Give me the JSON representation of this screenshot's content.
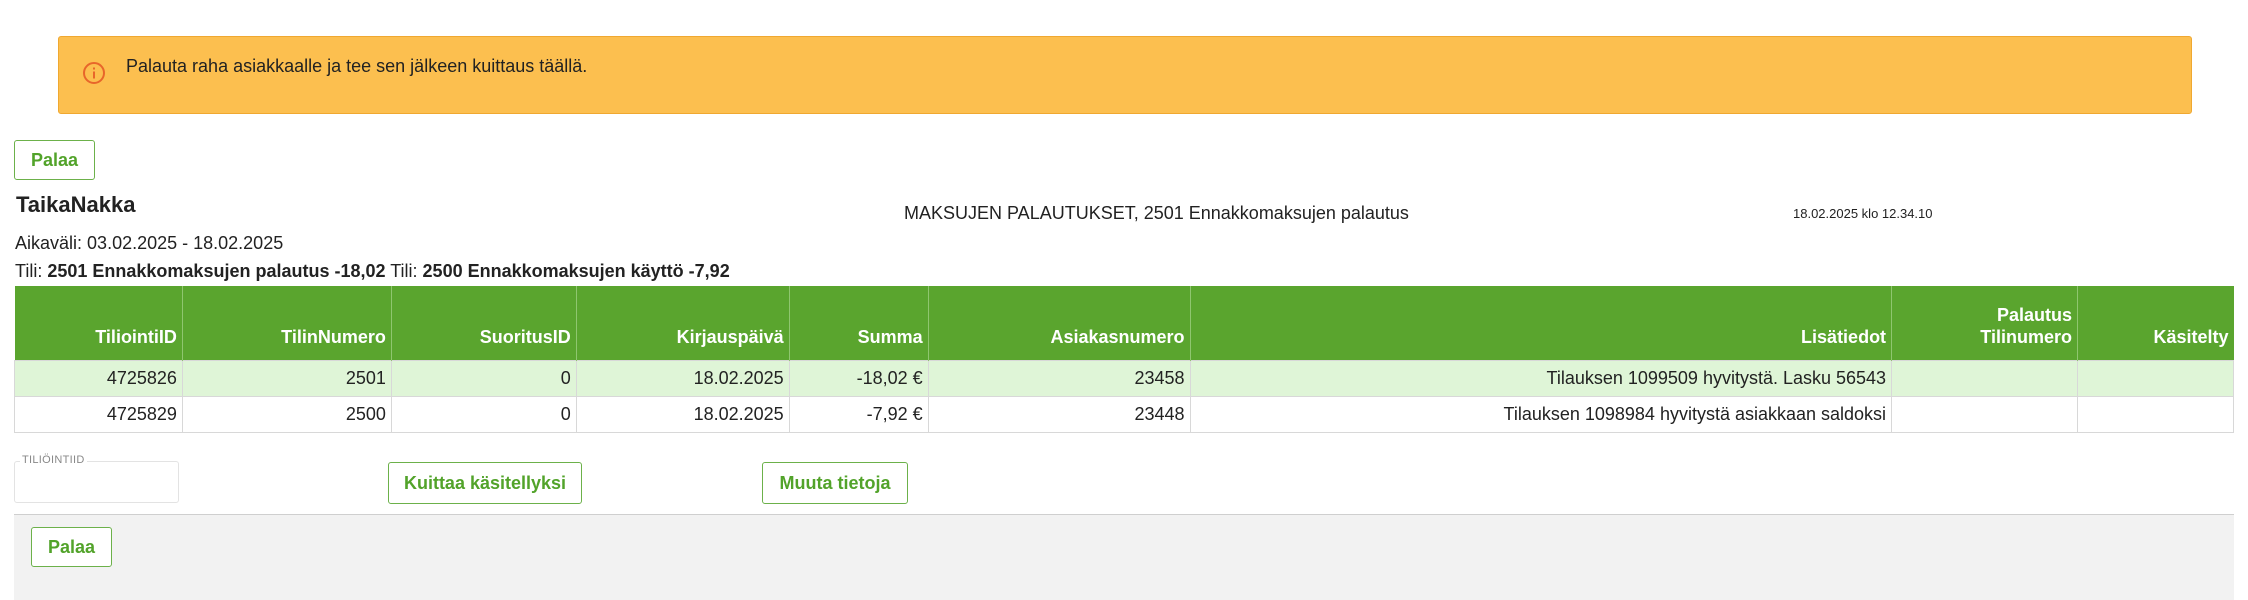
{
  "alert": {
    "icon": "info-icon",
    "text": "Palauta raha asiakkaalle ja tee sen jälkeen kuittaus täällä."
  },
  "buttons": {
    "back_top": "Palaa",
    "acknowledge": "Kuittaa käsitellyksi",
    "edit": "Muuta tietoja",
    "back_bottom": "Palaa"
  },
  "report": {
    "company": "TaikaNakka",
    "title": "MAKSUJEN PALAUTUKSET, 2501 Ennakkomaksujen palautus",
    "timestamp": "18.02.2025 klo 12.34.10",
    "period_label": "Aikaväli:",
    "period_value": "03.02.2025 - 18.02.2025",
    "account1_label": "Tili:",
    "account1_value": "2501 Ennakkomaksujen palautus -18,02",
    "account2_label": "Tili:",
    "account2_value": "2500 Ennakkomaksujen käyttö -7,92"
  },
  "table": {
    "headers": [
      "TiliointiID",
      "TilinNumero",
      "SuoritusID",
      "Kirjauspäivä",
      "Summa",
      "Asiakasnumero",
      "Lisätiedot",
      "Palautus Tilinumero",
      "Käsitelty"
    ],
    "header_palautus_line1": "Palautus",
    "header_palautus_line2": "Tilinumero",
    "rows": [
      [
        "4725826",
        "2501",
        "0",
        "18.02.2025",
        "-18,02 €",
        "23458",
        "Tilauksen 1099509 hyvitystä. Lasku 56543",
        "",
        ""
      ],
      [
        "4725829",
        "2500",
        "0",
        "18.02.2025",
        "-7,92 €",
        "23448",
        "Tilauksen 1098984 hyvitystä asiakkaan saldoksi",
        "",
        ""
      ]
    ]
  },
  "form": {
    "tiliointiid_label": "TILIÖINTIID",
    "tiliointiid_value": ""
  },
  "colors": {
    "accent_green": "#5aa52e",
    "alert_bg": "#fcbf4f",
    "row_highlight": "#dff5d7"
  }
}
